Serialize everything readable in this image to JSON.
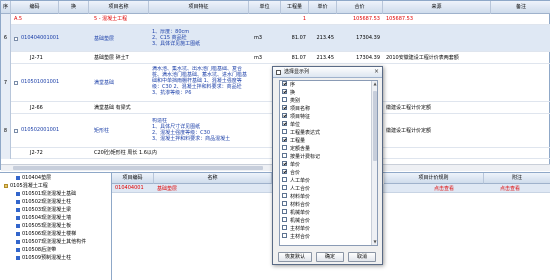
{
  "grid": {
    "columns": [
      "序",
      "编码",
      "换",
      "项目名称",
      "项目特征",
      "单位",
      "工程量",
      "单价",
      "合价",
      "来源",
      "备注"
    ],
    "rows": [
      {
        "rownum": "",
        "code": "A.5",
        "name": "5 - 混凝土工程",
        "feature": "",
        "unit": "",
        "qty": "1",
        "price": "",
        "total": "105687.53",
        "total2": "105687.53",
        "source": ""
      },
      {
        "rownum": "6",
        "code": "010404001001",
        "name": "基础垫层",
        "feature": "1、厚度：80cm\n2、C15 商品砼\n3、具体详见施工图纸",
        "unit": "m3",
        "qty": "81.07",
        "price": "213.45",
        "total": "17304.39",
        "source": ""
      },
      {
        "rownum": "",
        "code": "J2-71",
        "name": "基础垫层 碎土T",
        "feature": "",
        "unit": "m3",
        "qty": "81.07",
        "price": "213.45",
        "total": "17304.39",
        "source": "2010安徽建设工程计价表两套额"
      },
      {
        "rownum": "7",
        "code": "010501001001",
        "name": "满堂基础",
        "feature": "满水池、集水坑、出水池门槛基础、复合桩、满水池门槛基础、蓄水坑、进水门槛基础和中单挡雨棚杆基础\n1、混凝土强度等级：C30\n2、混凝土拌和料要求：商品砼\n3、抗渗等级：P6",
        "unit": "",
        "qty": "",
        "price": "",
        "total": "",
        "source": ""
      },
      {
        "rownum": "",
        "code": "J2-66",
        "name": "满堂基础 有梁式",
        "feature": "",
        "unit": "",
        "qty": "",
        "price": "",
        "total": "",
        "source": "徽建设工程计价定额"
      },
      {
        "rownum": "8",
        "code": "010502001001",
        "name": "矩形柱",
        "feature": "构造柱\n1、具体尺寸详见图纸\n2、混凝土强度等级：C30\n3、混凝土拌和料要求：商品混凝土",
        "unit": "",
        "qty": "",
        "price": "",
        "total": "",
        "source": "徽建设工程计价定额"
      },
      {
        "rownum": "",
        "code": "J2-72",
        "name": "C20砼)矩形柱 周长 1.6以内",
        "feature": "",
        "unit": "",
        "qty": "",
        "price": "",
        "total": "",
        "source": ""
      }
    ]
  },
  "tree": {
    "items": [
      "010404垫层",
      "0105混凝土工程",
      "010501现浇混凝土基础",
      "010502现浇混凝土柱",
      "010503现浇混凝土梁",
      "010504现浇混凝土墙",
      "010505现浇混凝土板",
      "010506现浇混凝土楼梯",
      "010507现浇混凝土其他构件",
      "010508后浇带",
      "010509预制混凝土柱"
    ]
  },
  "bottom_table": {
    "columns": [
      "项目编码",
      "名称",
      "",
      "项目计价规则",
      "附注"
    ],
    "row": {
      "code": "010404001",
      "name": "基础垫层",
      "rule": "",
      "note": "点击查看",
      "note2": "点击查看"
    }
  },
  "dialog": {
    "title": "选择显示列",
    "close": "×",
    "items": [
      {
        "label": "序",
        "checked": true
      },
      {
        "label": "换",
        "checked": true
      },
      {
        "label": "类别",
        "checked": false
      },
      {
        "label": "项目名称",
        "checked": true
      },
      {
        "label": "项目特征",
        "checked": true
      },
      {
        "label": "单位",
        "checked": true
      },
      {
        "label": "工程量表达式",
        "checked": false
      },
      {
        "label": "工程量",
        "checked": true
      },
      {
        "label": "定额含量",
        "checked": false
      },
      {
        "label": "按量计费标记",
        "checked": false
      },
      {
        "label": "单价",
        "checked": true
      },
      {
        "label": "合价",
        "checked": true
      },
      {
        "label": "人工单价",
        "checked": false
      },
      {
        "label": "人工合价",
        "checked": false
      },
      {
        "label": "材料单价",
        "checked": false
      },
      {
        "label": "材料合价",
        "checked": false
      },
      {
        "label": "机械单价",
        "checked": false
      },
      {
        "label": "机械合价",
        "checked": false
      },
      {
        "label": "主材单价",
        "checked": false
      },
      {
        "label": "主材合价",
        "checked": false
      }
    ],
    "buttons": {
      "restore": "恢复默认",
      "ok": "确定",
      "cancel": "取消"
    }
  }
}
